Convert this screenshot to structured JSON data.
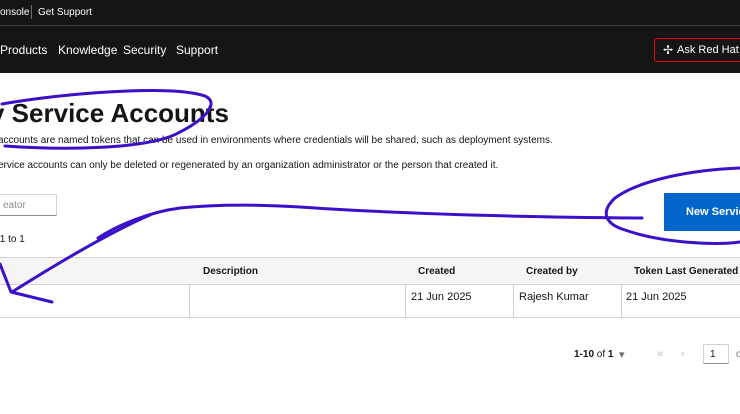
{
  "utility_bar": {
    "console_link": "onsole",
    "support_link": "Get Support"
  },
  "main_nav": {
    "items": [
      "Products",
      "Knowledge",
      "Security",
      "Support"
    ],
    "ask_button": "Ask Red Hat"
  },
  "page": {
    "title": "y Service Accounts",
    "description_1": "accounts are named tokens that can be used in environments where credentials will be shared, such as deployment systems.",
    "description_2": "ervice accounts can only be deleted or regenerated by an organization administrator or the person that created it."
  },
  "toolbar": {
    "filter_placeholder": "eator",
    "showing_text": "s 1 to 1",
    "new_button": "New Servic"
  },
  "table": {
    "columns": [
      "Description",
      "Created",
      "Created by",
      "Token Last Generated"
    ],
    "rows": [
      {
        "description": "",
        "created": "21 Jun 2025",
        "created_by": "Rajesh Kumar",
        "token_last_generated": "21 Jun 2025"
      }
    ]
  },
  "pagination": {
    "range": "1-10",
    "of_label": "of",
    "total": "1",
    "first": "«",
    "prev": "‹",
    "current_page": "1",
    "trailing": "o"
  },
  "annotation_color": "#3b10c8"
}
